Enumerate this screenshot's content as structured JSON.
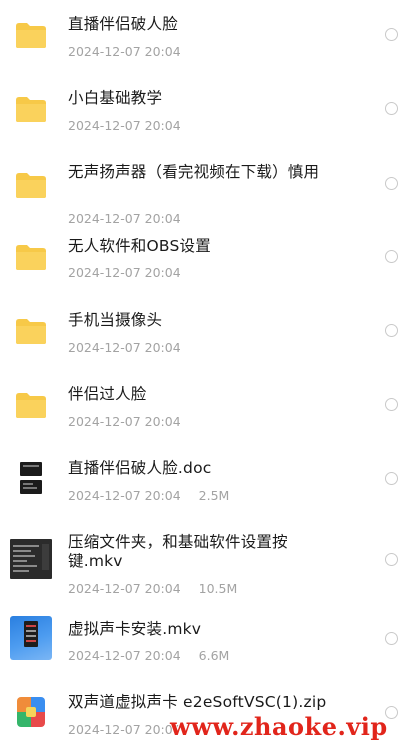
{
  "files": [
    {
      "name": "直播伴侣破人脸",
      "date": "2024-12-07 20:04",
      "size": "",
      "icon": "folder-icon"
    },
    {
      "name": "小白基础教学",
      "date": "2024-12-07 20:04",
      "size": "",
      "icon": "folder-icon"
    },
    {
      "name": "无声扬声器（看完视频在下载）慎用",
      "date": "2024-12-07 20:04",
      "size": "",
      "icon": "folder-icon"
    },
    {
      "name": "无人软件和OBS设置",
      "date": "2024-12-07 20:04",
      "size": "",
      "icon": "folder-icon"
    },
    {
      "name": "手机当摄像头",
      "date": "2024-12-07 20:04",
      "size": "",
      "icon": "folder-icon"
    },
    {
      "name": "伴侣过人脸",
      "date": "2024-12-07 20:04",
      "size": "",
      "icon": "folder-icon"
    },
    {
      "name": "直播伴侣破人脸.doc",
      "date": "2024-12-07 20:04",
      "size": "2.5M",
      "icon": "doc-thumbnail"
    },
    {
      "name": "压缩文件夹，和基础软件设置按键.mkv",
      "date": "2024-12-07 20:04",
      "size": "10.5M",
      "icon": "video-thumbnail"
    },
    {
      "name": "虚拟声卡安装.mkv",
      "date": "2024-12-07 20:04",
      "size": "6.6M",
      "icon": "video-thumbnail"
    },
    {
      "name": "双声道虚拟声卡 e2eSoftVSC(1).zip",
      "date": "2024-12-07 20:04",
      "size": "",
      "icon": "zip-archive-icon"
    }
  ],
  "watermark": "www.zhaoke.vip",
  "colors": {
    "folder": "#f7c948",
    "name_text": "#1a1a1a",
    "meta_text": "#a3a3a3",
    "radio_border": "#c9c9c9",
    "watermark": "#e1251b"
  }
}
